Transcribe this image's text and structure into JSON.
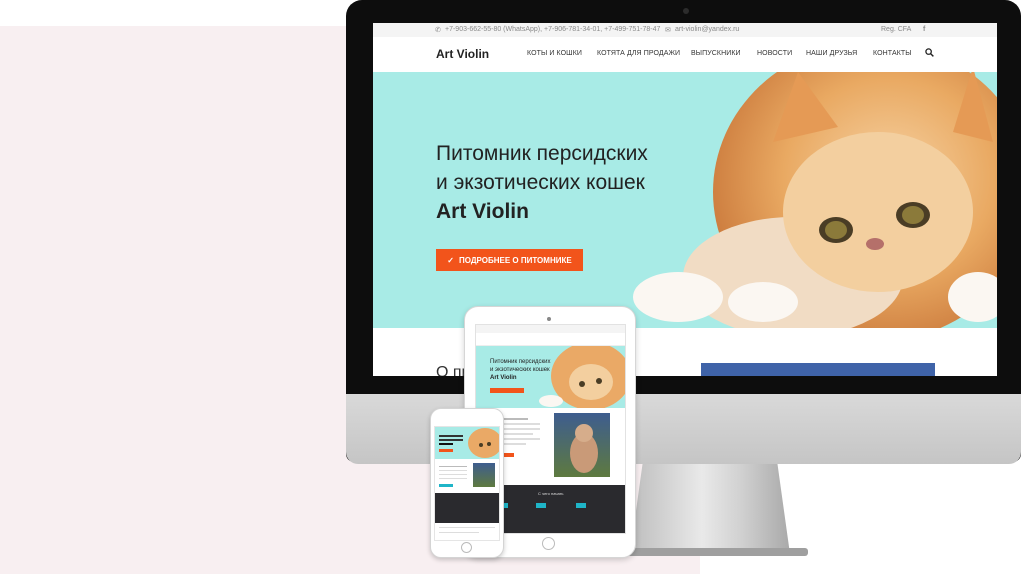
{
  "site": {
    "topbar": {
      "phones": "+7-903-662-55-80 (WhatsApp), +7-906-781-34-01, +7-499-751-78-47",
      "email": "art-violin@yandex.ru",
      "reg": "Reg. CFA",
      "social_icon": "facebook-icon"
    },
    "logo": "Art Violin",
    "nav": [
      {
        "label": "КОТЫ И КОШКИ"
      },
      {
        "label": "КОТЯТА ДЛЯ ПРОДАЖИ"
      },
      {
        "label": "ВЫПУСКНИКИ"
      },
      {
        "label": "НОВОСТИ"
      },
      {
        "label": "НАШИ ДРУЗЬЯ"
      },
      {
        "label": "КОНТАКТЫ"
      }
    ],
    "search_icon": "search-icon",
    "hero": {
      "line1": "Питомник персидских",
      "line2": "и экзотических кошек",
      "line3": "Art Violin",
      "button_label": "ПОДРОБНЕЕ О ПИТОМНИКЕ",
      "button_icon": "check-icon"
    },
    "below_title": "О пи"
  },
  "tablet": {
    "hero_line1": "Питомник персидских",
    "hero_line2": "и экзотических кошек",
    "hero_line3": "Art Violin",
    "section_label": "С чего начать"
  },
  "colors": {
    "accent": "#f2541b",
    "hero_bg": "#a8ebe6",
    "page_bg": "#f8eff1"
  }
}
